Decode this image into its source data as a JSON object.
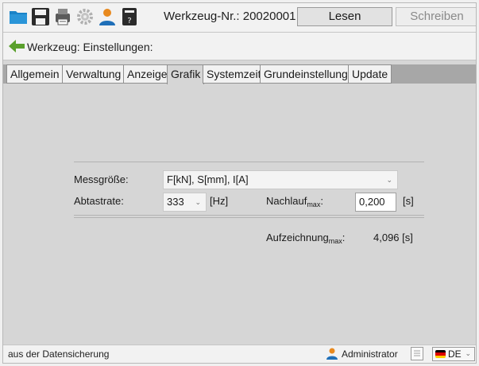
{
  "toolbar": {
    "icons": [
      "folder-icon",
      "save-icon",
      "print-icon",
      "settings-icon",
      "user-icon",
      "device-info-icon"
    ],
    "title": "Werkzeug-Nr.: 20020001",
    "read_label": "Lesen",
    "write_label": "Schreiben"
  },
  "header": {
    "back_icon": "back-arrow-icon",
    "title": "Werkzeug: Einstellungen:"
  },
  "tabs": [
    {
      "label": "Allgemein",
      "active": false
    },
    {
      "label": "Verwaltung",
      "active": false
    },
    {
      "label": "Anzeige",
      "active": false
    },
    {
      "label": "Grafik",
      "active": true
    },
    {
      "label": "Systemzeit",
      "active": false
    },
    {
      "label": "Grundeinstellung",
      "active": false
    },
    {
      "label": "Update",
      "active": false
    }
  ],
  "form": {
    "measurand_label": "Messgröße:",
    "measurand_value": "F[kN], S[mm], I[A]",
    "sample_rate_label": "Abtastrate:",
    "sample_rate_value": "333",
    "sample_rate_unit": "[Hz]",
    "afterrun_label": "Nachlauf",
    "afterrun_sub": "max",
    "afterrun_value": "0,200",
    "afterrun_unit": "[s]",
    "recording_label": "Aufzeichnung",
    "recording_sub": "max",
    "recording_value": "4,096 [s]"
  },
  "status": {
    "left_text": "aus der Datensicherung",
    "user": "Administrator",
    "language": "DE"
  },
  "colors": {
    "folder": "#1a83c8",
    "toolbar_icon": "#2b2b2b",
    "back_arrow": "#5aa02c",
    "user_orange": "#e8891e",
    "user_blue": "#1f6fb8",
    "flag": [
      "#000000",
      "#dd0000",
      "#ffce00"
    ]
  }
}
